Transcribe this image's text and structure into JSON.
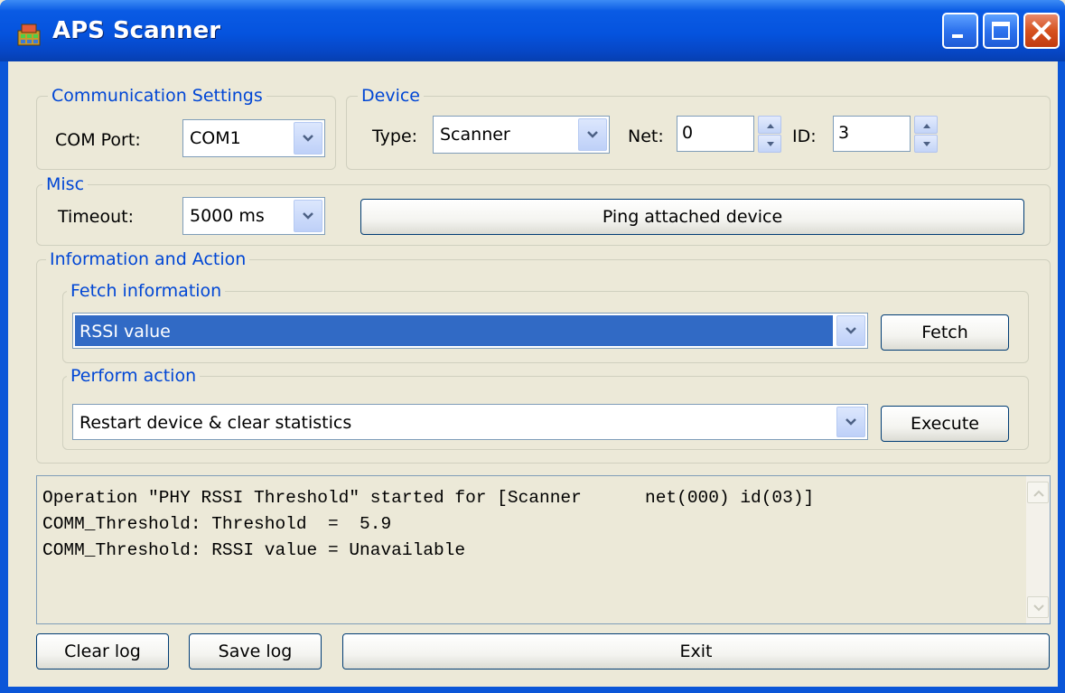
{
  "window": {
    "title": "APS Scanner"
  },
  "comm": {
    "legend": "Communication Settings",
    "com_port_label": "COM Port:",
    "com_port_value": "COM1"
  },
  "device": {
    "legend": "Device",
    "type_label": "Type:",
    "type_value": "Scanner",
    "net_label": "Net:",
    "net_value": "0",
    "id_label": "ID:",
    "id_value": "3"
  },
  "misc": {
    "legend": "Misc",
    "timeout_label": "Timeout:",
    "timeout_value": "5000 ms",
    "ping_label": "Ping attached device"
  },
  "info": {
    "legend": "Information and Action",
    "fetch_legend": "Fetch information",
    "fetch_value": "RSSI value",
    "fetch_button": "Fetch",
    "action_legend": "Perform action",
    "action_value": "Restart device & clear statistics",
    "execute_button": "Execute"
  },
  "log": {
    "lines": [
      "Operation \"PHY RSSI Threshold\" started for [Scanner      net(000) id(03)]",
      "COMM_Threshold: Threshold  =  5.9",
      "COMM_Threshold: RSSI value = Unavailable"
    ]
  },
  "footer": {
    "clear_log": "Clear log",
    "save_log": "Save log",
    "exit": "Exit"
  },
  "icons": {
    "app": "app-icon",
    "minimize": "minimize-icon",
    "maximize": "maximize-icon",
    "close": "close-icon",
    "dropdown": "chevron-down-icon",
    "spin_up": "spin-up-icon",
    "spin_down": "spin-down-icon"
  },
  "colors": {
    "title_bar": "#0553de",
    "legend_text": "#0046d5",
    "selection": "#316ac5",
    "dialog_bg": "#ece9d8",
    "close_button": "#d6521f"
  }
}
